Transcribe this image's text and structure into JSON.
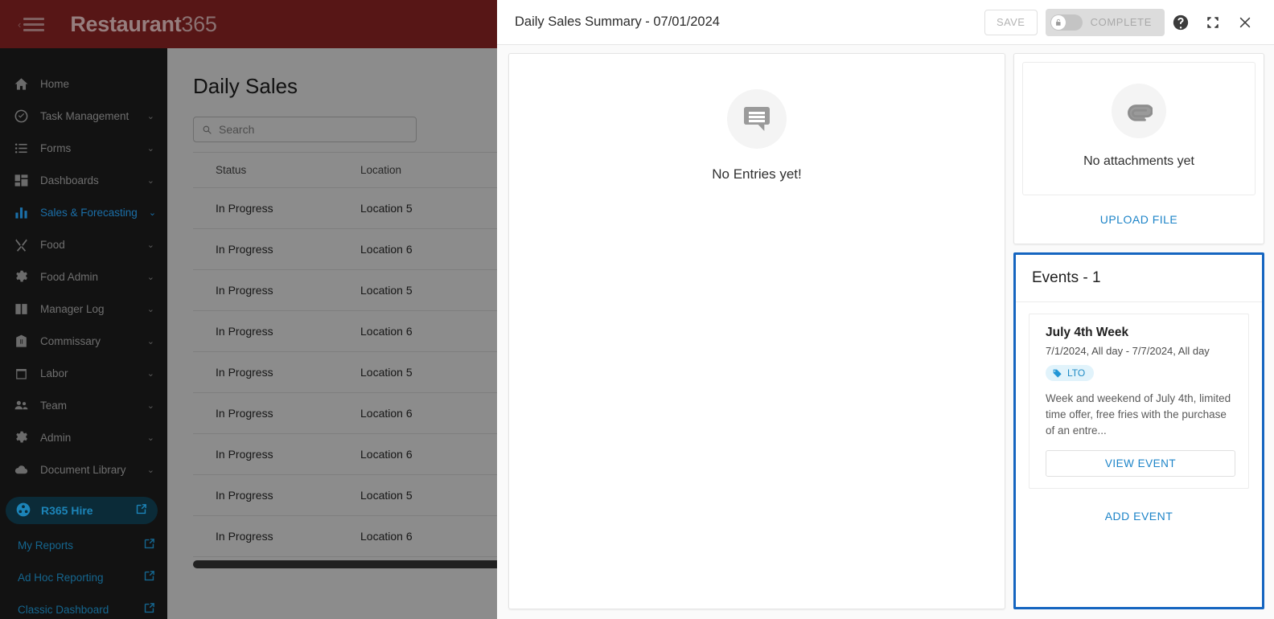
{
  "topbar": {
    "brand_bold": "Restaurant",
    "brand_light": "365",
    "menu_icon": "hamburger-menu-icon",
    "bg_color": "#6B1B1B"
  },
  "sidebar": {
    "items": [
      {
        "label": "Home",
        "icon": "home-icon",
        "chevron": "",
        "active": false
      },
      {
        "label": "Task Management",
        "icon": "check-circle-icon",
        "chevron": "⌄",
        "active": false
      },
      {
        "label": "Forms",
        "icon": "list-icon",
        "chevron": "⌄",
        "active": false
      },
      {
        "label": "Dashboards",
        "icon": "grid-icon",
        "chevron": "⌄",
        "active": false
      },
      {
        "label": "Sales & Forecasting",
        "icon": "bar-chart-icon",
        "chevron": "⌄",
        "active": true
      },
      {
        "label": "Food",
        "icon": "utensils-icon",
        "chevron": "⌄",
        "active": false
      },
      {
        "label": "Food Admin",
        "icon": "gear-icon",
        "chevron": "⌄",
        "active": false
      },
      {
        "label": "Manager Log",
        "icon": "book-icon",
        "chevron": "⌄",
        "active": false
      },
      {
        "label": "Commissary",
        "icon": "warehouse-icon",
        "chevron": "⌄",
        "active": false
      },
      {
        "label": "Labor",
        "icon": "calendar-icon",
        "chevron": "⌄",
        "active": false
      },
      {
        "label": "Team",
        "icon": "people-icon",
        "chevron": "⌄",
        "active": false
      },
      {
        "label": "Admin",
        "icon": "gear-icon",
        "chevron": "⌄",
        "active": false
      },
      {
        "label": "Document Library",
        "icon": "cloud-icon",
        "chevron": "⌄",
        "active": false
      }
    ],
    "hire_button": {
      "label": "R365 Hire",
      "icon": "r365-hire-icon",
      "external_icon": "external-link-icon"
    },
    "sub_links": [
      {
        "label": "My Reports",
        "external_icon": "external-link-icon"
      },
      {
        "label": "Ad Hoc Reporting",
        "external_icon": "external-link-icon"
      },
      {
        "label": "Classic Dashboard",
        "external_icon": "external-link-icon"
      }
    ]
  },
  "page": {
    "title": "Daily Sales",
    "search_placeholder": "Search",
    "search_value": "",
    "table": {
      "columns": [
        "Status",
        "Location"
      ],
      "rows": [
        [
          "In Progress",
          "Location 5"
        ],
        [
          "In Progress",
          "Location 6"
        ],
        [
          "In Progress",
          "Location 5"
        ],
        [
          "In Progress",
          "Location 6"
        ],
        [
          "In Progress",
          "Location 5"
        ],
        [
          "In Progress",
          "Location 6"
        ],
        [
          "In Progress",
          "Location 6"
        ],
        [
          "In Progress",
          "Location 5"
        ],
        [
          "In Progress",
          "Location 6"
        ]
      ]
    }
  },
  "modal": {
    "title": "Daily Sales Summary - 07/01/2024",
    "save_label": "SAVE",
    "complete_label": "COMPLETE",
    "complete_toggle_state": "off",
    "help_icon": "help-icon",
    "expand_icon": "fullscreen-icon",
    "close_icon": "close-icon",
    "entries": {
      "icon": "comment-lines-icon",
      "empty_text": "No Entries yet!"
    },
    "attachments": {
      "icon": "paperclip-icon",
      "empty_text": "No attachments yet",
      "upload_label": "UPLOAD FILE"
    },
    "events": {
      "title": "Events - 1",
      "highlight_color": "#1565C0",
      "add_label": "ADD EVENT",
      "items": [
        {
          "name": "July 4th Week",
          "date_range": "7/1/2024, All day - 7/7/2024, All day",
          "tag": "LTO",
          "tag_icon": "tag-icon",
          "description": "Week and weekend of July 4th, limited time offer, free fries with the purchase of an entre...",
          "view_label": "VIEW EVENT"
        }
      ]
    }
  }
}
